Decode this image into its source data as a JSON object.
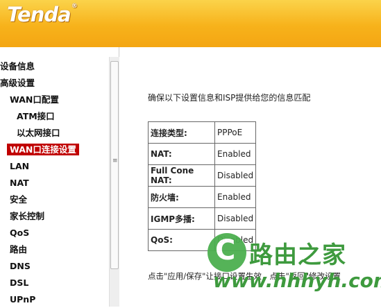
{
  "header": {
    "logo": "Tenda",
    "reg": "®"
  },
  "sidebar": {
    "items": [
      {
        "label": "设备信息",
        "level": 0
      },
      {
        "label": "高级设置",
        "level": 0
      },
      {
        "label": "WAN口配置",
        "level": 1
      },
      {
        "label": "ATM接口",
        "level": 2
      },
      {
        "label": "以太网接口",
        "level": 2
      },
      {
        "label": "WAN口连接设置",
        "level": 1,
        "selected": true
      },
      {
        "label": "LAN",
        "level": 1
      },
      {
        "label": "NAT",
        "level": 1
      },
      {
        "label": "安全",
        "level": 1
      },
      {
        "label": "家长控制",
        "level": 1
      },
      {
        "label": "QoS",
        "level": 1
      },
      {
        "label": "路由",
        "level": 1
      },
      {
        "label": "DNS",
        "level": 1
      },
      {
        "label": "DSL",
        "level": 1
      },
      {
        "label": "UPnP",
        "level": 1
      }
    ]
  },
  "main": {
    "intro": "确保以下设置信息和ISP提供给您的信息匹配",
    "rows": [
      {
        "key": "连接类型:",
        "value": "PPPoE"
      },
      {
        "key": "NAT:",
        "value": "Enabled"
      },
      {
        "key": "Full Cone NAT:",
        "value": "Disabled"
      },
      {
        "key": "防火墙:",
        "value": "Enabled"
      },
      {
        "key": "IGMP多播:",
        "value": "Disabled"
      },
      {
        "key": "QoS:",
        "value": "Disabled"
      }
    ],
    "footer": "点击\"应用/保存\"让接口设置生效，点击\"返回\"修改设置"
  },
  "watermark": {
    "char": "C",
    "title": "路由之家",
    "url": "www.hhhyh.com"
  }
}
